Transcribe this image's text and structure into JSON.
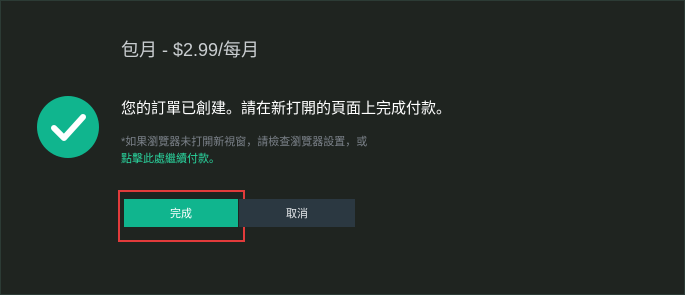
{
  "dialog": {
    "plan_title": "包月 - $2.99/每月",
    "message": "您的訂單已創建。請在新打開的頁面上完成付款。",
    "hint": "*如果瀏覽器未打開新視窗，請檢查瀏覽器設置，或",
    "continue_link": "點擊此處繼續付款。",
    "done_label": "完成",
    "cancel_label": "取消"
  },
  "colors": {
    "background": "#1f2420",
    "accent": "#10b58e",
    "link": "#2ad69f",
    "cancel_bg": "#2b3841",
    "highlight": "#e23b3b"
  },
  "icons": {
    "status": "check-circle-icon"
  }
}
